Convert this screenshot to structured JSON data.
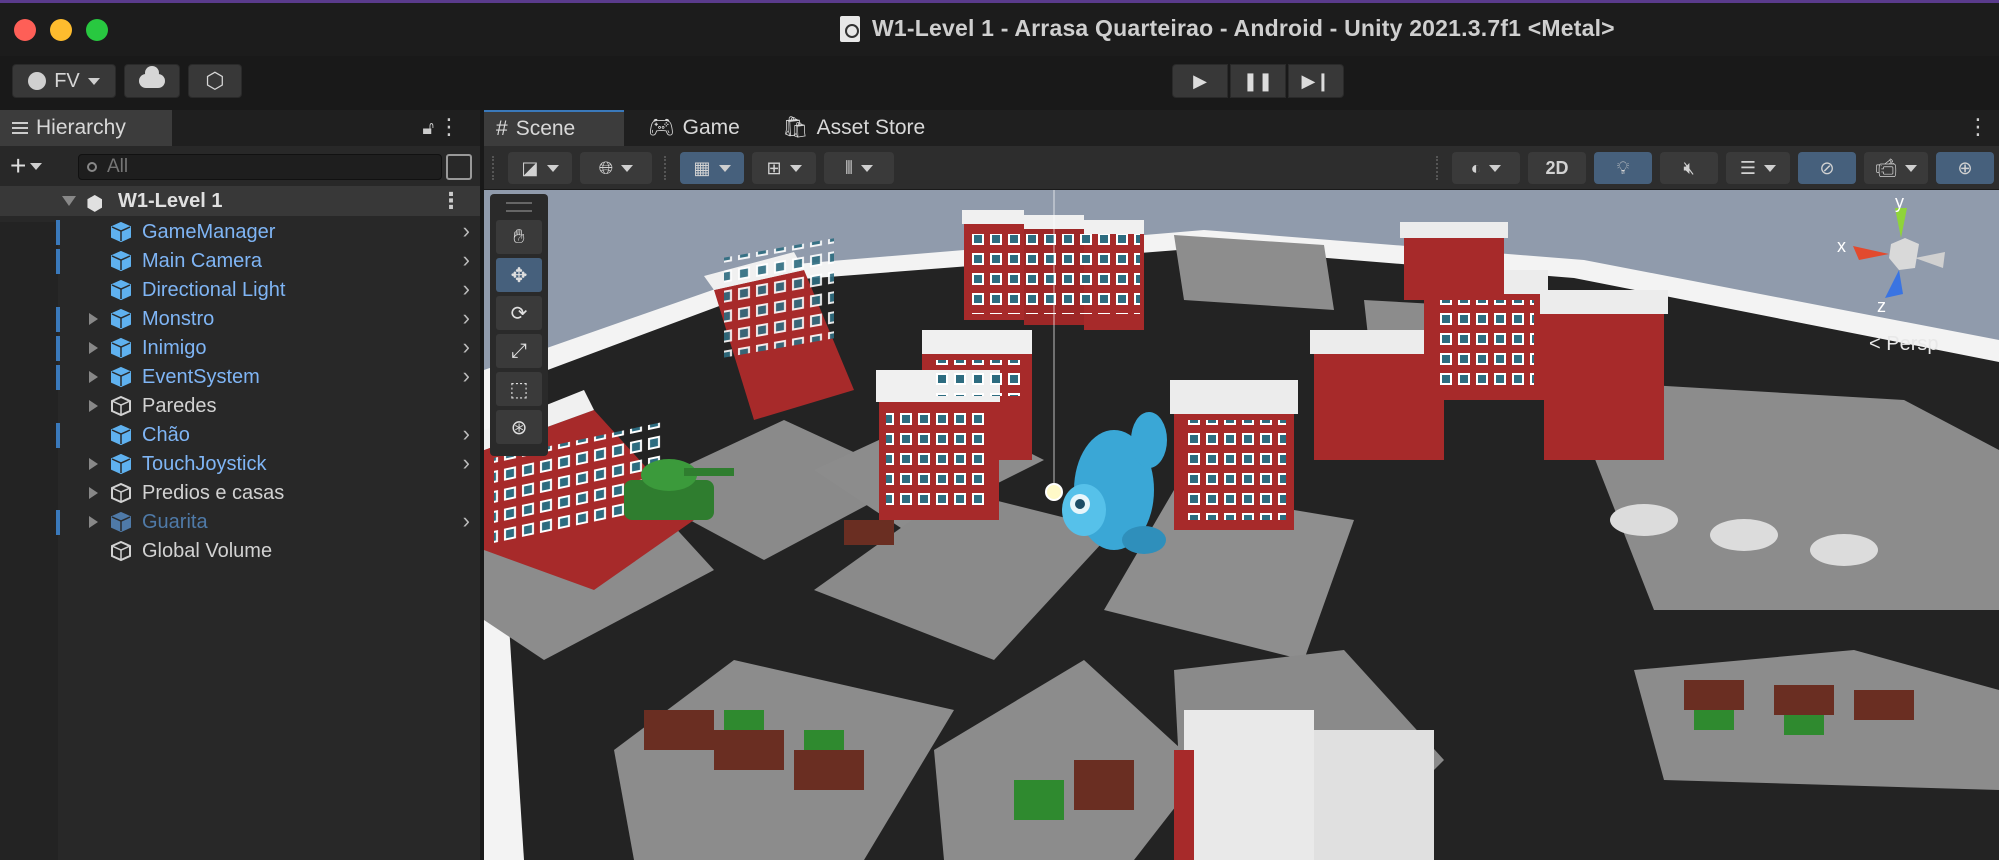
{
  "window": {
    "title": "W1-Level 1 - Arrasa Quarteirao - Android - Unity 2021.3.7f1 <Metal>"
  },
  "toolbar": {
    "account_label": "FV",
    "play": "▶",
    "pause": "❚❚",
    "step": "▶❙"
  },
  "hierarchy": {
    "tab_label": "Hierarchy",
    "search_placeholder": "All",
    "scene_name": "W1-Level 1",
    "items": [
      {
        "label": "GameManager",
        "type": "prefab",
        "marked": true,
        "expandable": false,
        "chevron": true
      },
      {
        "label": "Main Camera",
        "type": "prefab",
        "marked": true,
        "expandable": false,
        "chevron": true
      },
      {
        "label": "Directional Light",
        "type": "prefab",
        "marked": false,
        "expandable": false,
        "chevron": true
      },
      {
        "label": "Monstro",
        "type": "prefab",
        "marked": true,
        "expandable": true,
        "chevron": true
      },
      {
        "label": "Inimigo",
        "type": "prefab",
        "marked": true,
        "expandable": true,
        "chevron": true
      },
      {
        "label": "EventSystem",
        "type": "prefab",
        "marked": true,
        "expandable": true,
        "chevron": true
      },
      {
        "label": "Paredes",
        "type": "plain",
        "marked": false,
        "expandable": true,
        "chevron": false
      },
      {
        "label": "Chão",
        "type": "prefab",
        "marked": true,
        "expandable": false,
        "chevron": true
      },
      {
        "label": "TouchJoystick",
        "type": "prefab",
        "marked": false,
        "expandable": true,
        "chevron": true
      },
      {
        "label": "Predios e casas",
        "type": "plain",
        "marked": false,
        "expandable": true,
        "chevron": false
      },
      {
        "label": "Guarita",
        "type": "disabled",
        "marked": true,
        "expandable": true,
        "chevron": true
      },
      {
        "label": "Global Volume",
        "type": "plain",
        "marked": false,
        "expandable": false,
        "chevron": false
      }
    ]
  },
  "scene_panel": {
    "tabs": [
      "Scene",
      "Game",
      "Asset Store"
    ],
    "toggle_2d": "2D",
    "gizmo": {
      "x_label": "x",
      "y_label": "y",
      "z_label": "z",
      "projection": "< Persp"
    }
  },
  "colors": {
    "accent": "#3a79bb",
    "prefab_text": "#7fb5f5",
    "panel_bg": "#282828"
  }
}
